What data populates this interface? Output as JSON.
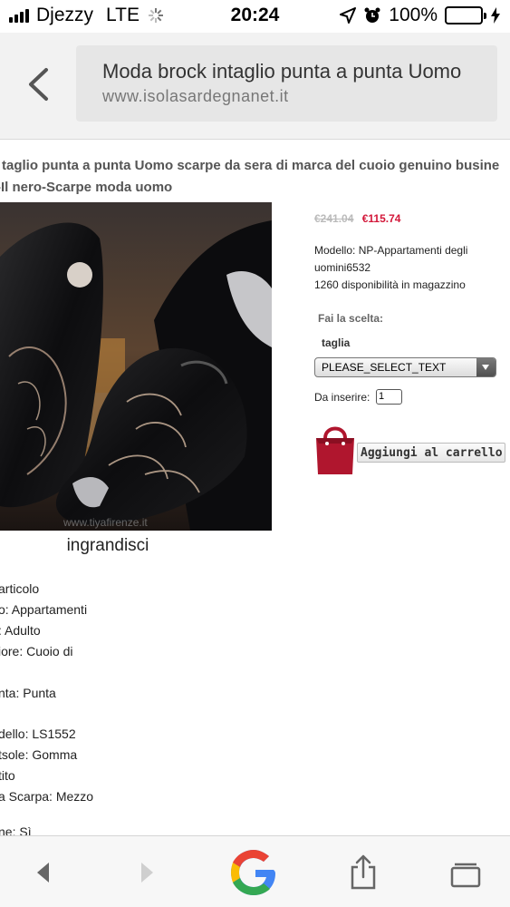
{
  "status_bar": {
    "carrier": "Djezzy",
    "network": "LTE",
    "time": "20:24",
    "battery_percent": "100%",
    "battery_level": 1.0,
    "battery_color": "#4cd964",
    "icons": [
      "signal-icon",
      "loading-icon",
      "location-icon",
      "alarm-icon",
      "battery-icon",
      "charging-icon"
    ]
  },
  "browser": {
    "page_title": "Moda brock intaglio punta a punta Uomo",
    "host": "www.isolasardegnanet.it",
    "back_icon": "chevron-left-icon"
  },
  "product": {
    "title_line1": "taglio punta a punta Uomo scarpe da sera di marca del cuoio genuino busine",
    "title_line2": "-Il nero-Scarpe moda uomo",
    "image_watermark": "www.tiyafirenze.it",
    "enlarge_label": "ingrandisci",
    "price_old": "€241.04",
    "price_new": "€115.74",
    "price_new_color": "#d3183a",
    "model": "Modello: NP-Appartamenti degli uomini6532",
    "stock": "1260 disponibilità in magazzino",
    "choice_label": "Fai la scelta:",
    "size_label": "taglia",
    "size_selected": "PLEASE_SELECT_TEXT",
    "qty_label": "Da inserire:",
    "qty_value": "1",
    "cart_label": "Aggiungi al carrello",
    "cart_bag_color": "#b0162e"
  },
  "details": [
    "articolo",
    "o: Appartamenti",
    ": Adulto",
    "iore: Cuoio di",
    "nta: Punta",
    "dello: LS1552",
    "tsole: Gomma",
    "tito",
    "a Scarpa: Mezzo",
    "ne: Sì"
  ],
  "toolbar": {
    "icons": [
      "back-arrow-icon",
      "forward-arrow-icon",
      "google-logo-icon",
      "share-icon",
      "tabs-icon"
    ]
  }
}
